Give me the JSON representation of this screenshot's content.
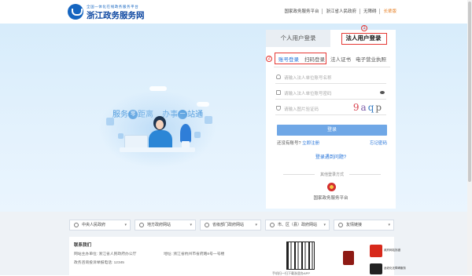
{
  "header": {
    "logo_subtitle": "全国一体化在线政务服务平台",
    "logo_title": "浙江政务服务网",
    "nav": [
      {
        "label": "国家政务服务平台"
      },
      {
        "label": "浙江省人民政府"
      },
      {
        "label": "无障碍"
      },
      {
        "label": "长辈版"
      }
    ]
  },
  "hero": {
    "slogan": {
      "part1_prefix": "服务",
      "part1_char": "零",
      "part1_suffix": "距离",
      "part2_prefix": "办事",
      "part2_char": "一",
      "part2_suffix": "站通"
    }
  },
  "login": {
    "role_tabs": [
      "个人用户登录",
      "法人用户登录"
    ],
    "active_role": "法人用户登录",
    "annotations": [
      "1",
      "2"
    ],
    "sub_tabs": [
      "账号登录",
      "扫码登录",
      "法人证书",
      "电子营业执照"
    ],
    "active_sub_tab": "账号登录",
    "fields": {
      "account_placeholder": "请输入法人单位账号名称",
      "password_placeholder": "请输入法人单位账号密码",
      "captcha_placeholder": "请输入图片验证码"
    },
    "captcha_text": [
      "9",
      "a",
      "q",
      "p"
    ],
    "login_button": "登录",
    "no_account_text": "还没有账号?",
    "register_link": "立即注册",
    "forgot_link": "忘记密码",
    "help_link": "登录遇到问题?",
    "other_ways_label": "其他登录方式",
    "national_platform_label": "国家政务服务平台"
  },
  "bottom_links": [
    {
      "label": "中央人民政府"
    },
    {
      "label": "地方政府网站"
    },
    {
      "label": "省级部门政府网站"
    },
    {
      "label": "市、区（县）政府网站"
    },
    {
      "label": "友情链接"
    }
  ],
  "footer": {
    "title": "联系我们",
    "org_label": "网站主办单位: 浙江省人民政府办公厅",
    "address_label": "地址: 浙江省杭州市省府路8号一号楼",
    "hotline": "政务咨询投诉举报电话: 12345",
    "qr_caption": "手机扫一扫下载浙里办APP",
    "badge_captions": [
      "政府网站找错",
      "适老化无障碍服务"
    ]
  },
  "colors": {
    "accent_blue": "#1e6fd8",
    "annotation_red": "#e53935",
    "login_button": "#6fa7e6",
    "highlight_orange": "#e67e22"
  }
}
